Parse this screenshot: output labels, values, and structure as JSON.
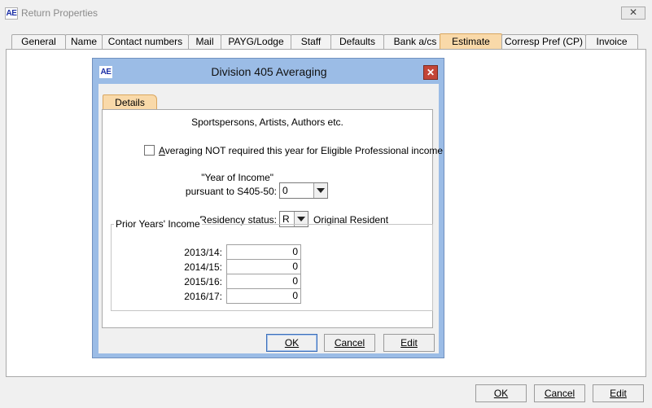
{
  "window": {
    "logo": "AE",
    "title": "Return Properties",
    "close_glyph": "✕"
  },
  "tabs": [
    {
      "label": "General"
    },
    {
      "label": "Name"
    },
    {
      "label": "Contact numbers"
    },
    {
      "label": "Mail"
    },
    {
      "label": "PAYG/Lodge"
    },
    {
      "label": "Staff"
    },
    {
      "label": "Defaults"
    },
    {
      "label": "Bank a/cs"
    },
    {
      "label": "Estimate",
      "active": true
    },
    {
      "label": "Corresp Pref (CP)"
    },
    {
      "label": "Invoice"
    }
  ],
  "main_buttons": {
    "ok": "OK",
    "cancel": "Cancel",
    "edit": "Edit"
  },
  "dialog": {
    "logo": "AE",
    "title": "Division 405 Averaging",
    "close_glyph": "✕",
    "tab_label": "Details",
    "subtitle": "Sportspersons, Artists, Authors etc.",
    "checkbox_label": "Averaging NOT required this year for Eligible Professional income",
    "checkbox_checked": false,
    "year_of_income_label_1": "\"Year of Income\"",
    "year_of_income_label_2": "pursuant to S405-50:",
    "year_of_income_value": "0",
    "residency_label": "Residency status:",
    "residency_value": "R",
    "residency_desc": "Original Resident",
    "prior_group_title": "Prior Years' Income",
    "prior_years": [
      {
        "year": "2013/14:",
        "value": "0"
      },
      {
        "year": "2014/15:",
        "value": "0"
      },
      {
        "year": "2015/16:",
        "value": "0"
      },
      {
        "year": "2016/17:",
        "value": "0"
      }
    ],
    "buttons": {
      "ok": "OK",
      "cancel": "Cancel",
      "edit": "Edit"
    }
  },
  "colors": {
    "active_tab": "#f9d9a9",
    "dialog_frame": "#9bbce6",
    "dialog_close": "#c34537",
    "app_logo_text": "#1c2fa6"
  }
}
